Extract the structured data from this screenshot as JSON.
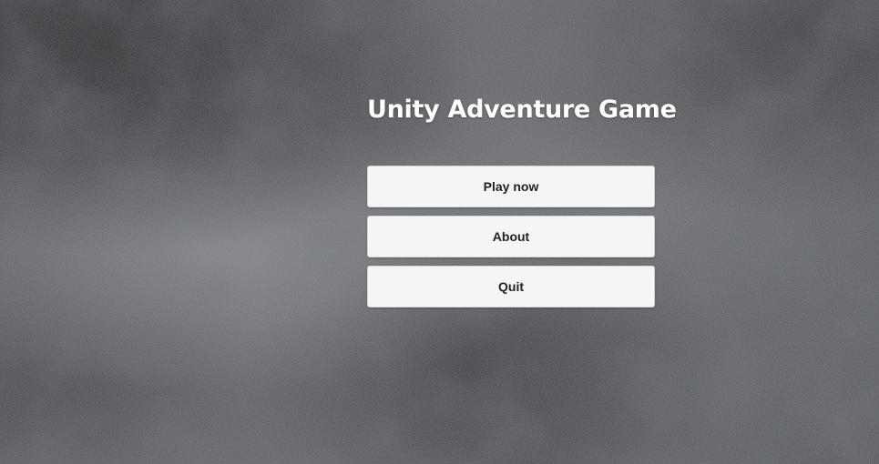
{
  "game": {
    "title": "Unity Adventure Game"
  },
  "menu": {
    "play_label": "Play now",
    "about_label": "About",
    "quit_label": "Quit"
  },
  "colors": {
    "title": "#ffffff",
    "button_bg": "#f5f5f5",
    "button_text": "#222222",
    "background": "#5c5f62"
  }
}
